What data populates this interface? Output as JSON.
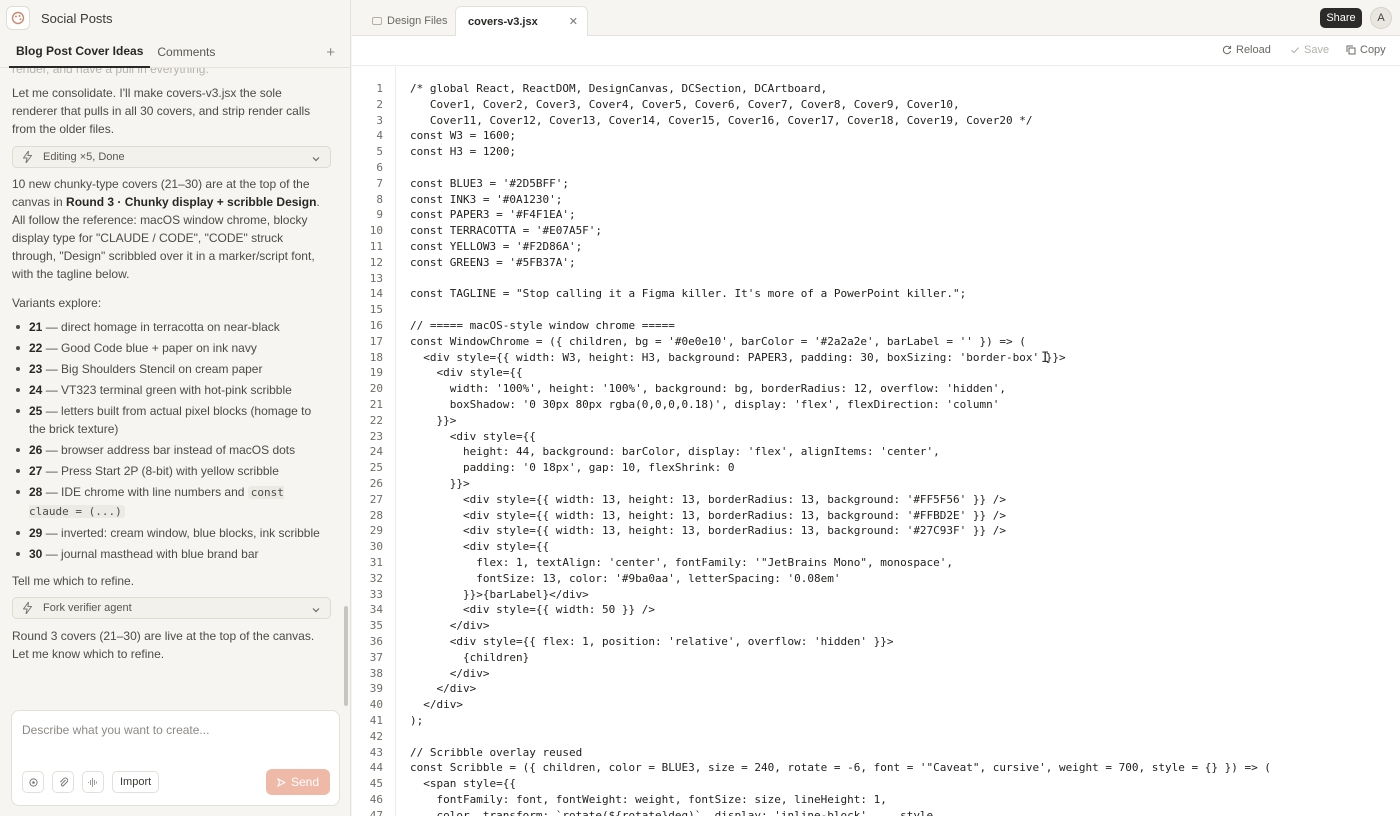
{
  "app": {
    "title": "Social Posts"
  },
  "left_tabs": [
    {
      "label": "Blog Post Cover Ideas"
    },
    {
      "label": "Comments"
    }
  ],
  "chat": {
    "faded_text": "render, and have a pull in everything.",
    "msg1": "Let me consolidate. I'll make covers-v3.jsx the sole renderer that pulls in all 30 covers, and strip render calls from the older files.",
    "tool1": "Editing ×5, Done",
    "msg2_before": "10 new chunky-type covers (21–30) are at the top of the canvas in ",
    "msg2_bold": "Round 3 · Chunky display + scribble Design",
    "msg2_after": ". All follow the reference: macOS window chrome, blocky display type for \"CLAUDE / CODE\", \"CODE\" struck through, \"Design\" scribbled over it in a marker/script font, with the tagline below.",
    "variants_heading": "Variants explore:",
    "variants": [
      {
        "num": "21",
        "text": " — direct homage in terracotta on near-black"
      },
      {
        "num": "22",
        "text": " — Good Code blue + paper on ink navy"
      },
      {
        "num": "23",
        "text": " — Big Shoulders Stencil on cream paper"
      },
      {
        "num": "24",
        "text": " — VT323 terminal green with hot-pink scribble"
      },
      {
        "num": "25",
        "text": " — letters built from actual pixel blocks (homage to the brick texture)"
      },
      {
        "num": "26",
        "text": " — browser address bar instead of macOS dots"
      },
      {
        "num": "27",
        "text": " — Press Start 2P (8-bit) with yellow scribble"
      },
      {
        "num": "28",
        "text": " — IDE chrome with line numbers and ",
        "code": "const claude = (...)"
      },
      {
        "num": "29",
        "text": " — inverted: cream window, blue blocks, ink scribble"
      },
      {
        "num": "30",
        "text": " — journal masthead with blue brand bar"
      }
    ],
    "refine_prompt": "Tell me which to refine.",
    "tool2": "Fork verifier agent",
    "msg3": "Round 3 covers (21–30) are live at the top of the canvas. Let me know which to refine."
  },
  "composer": {
    "placeholder": "Describe what you want to create...",
    "import_label": "Import",
    "send_label": "Send"
  },
  "file_tabs": [
    {
      "label": "Design Files"
    },
    {
      "label": "covers-v3.jsx"
    }
  ],
  "topbar": {
    "share_label": "Share",
    "avatar_initial": "A"
  },
  "actions": {
    "reload": "Reload",
    "save": "Save",
    "copy": "Copy"
  },
  "colors": {
    "accent": "#EFB9A8",
    "share_bg": "#2C2B29"
  },
  "code_lines": [
    "/* global React, ReactDOM, DesignCanvas, DCSection, DCArtboard,",
    "   Cover1, Cover2, Cover3, Cover4, Cover5, Cover6, Cover7, Cover8, Cover9, Cover10,",
    "   Cover11, Cover12, Cover13, Cover14, Cover15, Cover16, Cover17, Cover18, Cover19, Cover20 */",
    "const W3 = 1600;",
    "const H3 = 1200;",
    "",
    "const BLUE3 = '#2D5BFF';",
    "const INK3 = '#0A1230';",
    "const PAPER3 = '#F4F1EA';",
    "const TERRACOTTA = '#E07A5F';",
    "const YELLOW3 = '#F2D86A';",
    "const GREEN3 = '#5FB37A';",
    "",
    "const TAGLINE = \"Stop calling it a Figma killer. It's more of a PowerPoint killer.\";",
    "",
    "// ===== macOS-style window chrome =====",
    "const WindowChrome = ({ children, bg = '#0e0e10', barColor = '#2a2a2e', barLabel = '' }) => (",
    "  <div style={{ width: W3, height: H3, background: PAPER3, padding: 30, boxSizing: 'border-box' }}>",
    "    <div style={{",
    "      width: '100%', height: '100%', background: bg, borderRadius: 12, overflow: 'hidden',",
    "      boxShadow: '0 30px 80px rgba(0,0,0,0.18)', display: 'flex', flexDirection: 'column'",
    "    }}>",
    "      <div style={{",
    "        height: 44, background: barColor, display: 'flex', alignItems: 'center',",
    "        padding: '0 18px', gap: 10, flexShrink: 0",
    "      }}>",
    "        <div style={{ width: 13, height: 13, borderRadius: 13, background: '#FF5F56' }} />",
    "        <div style={{ width: 13, height: 13, borderRadius: 13, background: '#FFBD2E' }} />",
    "        <div style={{ width: 13, height: 13, borderRadius: 13, background: '#27C93F' }} />",
    "        <div style={{",
    "          flex: 1, textAlign: 'center', fontFamily: '\"JetBrains Mono\", monospace',",
    "          fontSize: 13, color: '#9ba0aa', letterSpacing: '0.08em'",
    "        }}>{barLabel}</div>",
    "        <div style={{ width: 50 }} />",
    "      </div>",
    "      <div style={{ flex: 1, position: 'relative', overflow: 'hidden' }}>",
    "        {children}",
    "      </div>",
    "    </div>",
    "  </div>",
    ");",
    "",
    "// Scribble overlay reused",
    "const Scribble = ({ children, color = BLUE3, size = 240, rotate = -6, font = '\"Caveat\", cursive', weight = 700, style = {} }) => (",
    "  <span style={{",
    "    fontFamily: font, fontWeight: weight, fontSize: size, lineHeight: 1,",
    "    color, transform: `rotate(${rotate}deg)`, display: 'inline-block', ...style"
  ]
}
